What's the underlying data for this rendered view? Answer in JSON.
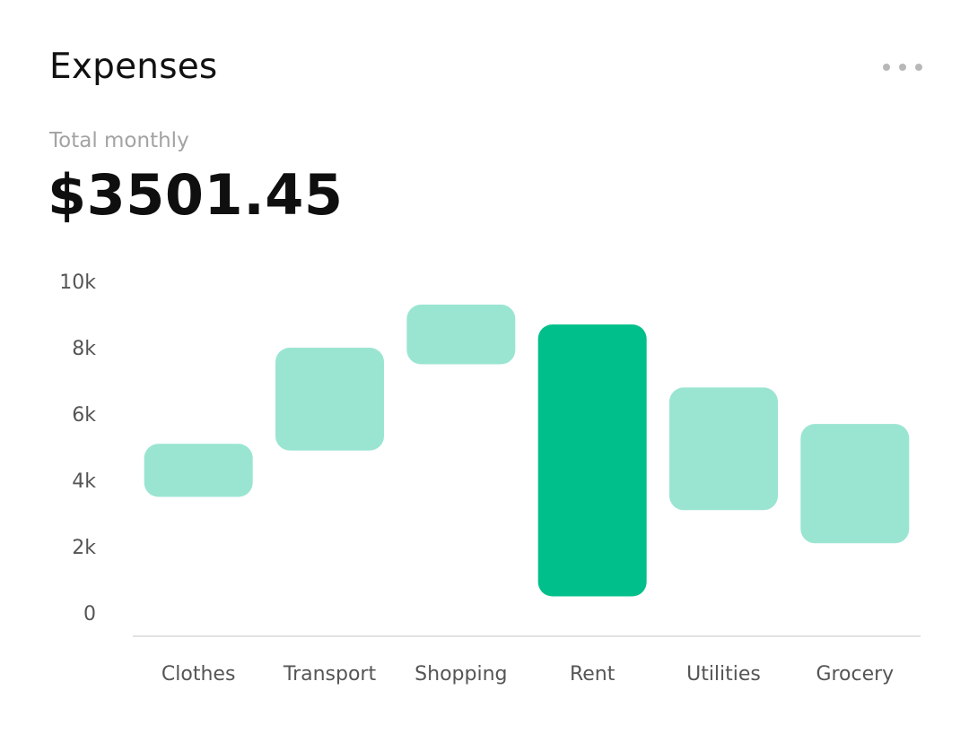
{
  "header": {
    "title": "Expenses",
    "menu_icon": "more-horizontal-icon"
  },
  "summary": {
    "label": "Total monthly",
    "value": "$3501.45"
  },
  "colors": {
    "bar": "#9ae5d1",
    "bar_highlight": "#00bf8a",
    "axis": "#d9d9d9",
    "tick_text": "#555555",
    "menu_dots": "#b8b8b8"
  },
  "chart_data": {
    "type": "bar",
    "subtype": "floating-range",
    "categories": [
      "Clothes",
      "Transport",
      "Shopping",
      "Rent",
      "Utilities",
      "Grocery"
    ],
    "ranges": [
      [
        3500,
        5100
      ],
      [
        4900,
        8000
      ],
      [
        7500,
        9300
      ],
      [
        500,
        8700
      ],
      [
        3100,
        6800
      ],
      [
        2100,
        5700
      ]
    ],
    "highlighted": "Rent",
    "yticks": [
      "0",
      "2k",
      "4k",
      "6k",
      "8k",
      "10k"
    ],
    "ylim": [
      0,
      10000
    ],
    "grid": false,
    "legend": false
  }
}
